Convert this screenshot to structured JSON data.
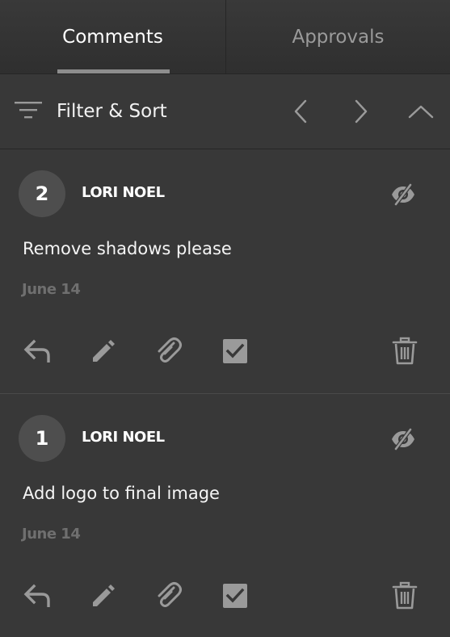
{
  "tabs": [
    {
      "label": "Comments",
      "active": true
    },
    {
      "label": "Approvals",
      "active": false
    }
  ],
  "toolbar": {
    "filter_label": "Filter & Sort",
    "filter_icon": "filter-icon",
    "prev_icon": "chevron-left-icon",
    "next_icon": "chevron-right-icon",
    "collapse_icon": "chevron-up-icon"
  },
  "comments": [
    {
      "number": "2",
      "author": "LORI NOEL",
      "text": "Remove shadows please",
      "date": "June 14",
      "actions": [
        "reply-icon",
        "edit-icon",
        "attach-icon",
        "checkbox-icon",
        "trash-icon"
      ]
    },
    {
      "number": "1",
      "author": "LORI NOEL",
      "text": "Add logo to final image",
      "date": "June 14",
      "actions": [
        "reply-icon",
        "edit-icon",
        "attach-icon",
        "checkbox-icon",
        "trash-icon"
      ]
    }
  ],
  "colors": {
    "background": "#383838",
    "icon": "#9a9a9a",
    "date": "#6f6f6f",
    "avatar": "#4e4e4e"
  }
}
